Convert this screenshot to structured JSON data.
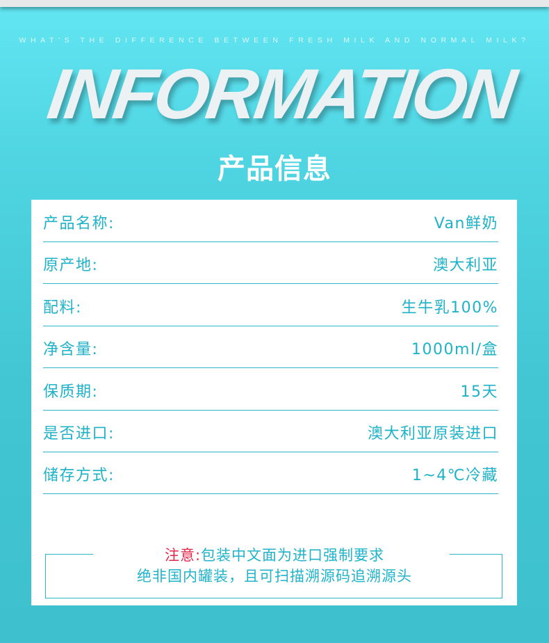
{
  "header": {
    "subtitle": "WHAT'S THE DIFFERENCE BETWEEN FRESH MILK AND NORMAL MILK?",
    "title_en": "INFORMATION",
    "title_cn": "产品信息"
  },
  "specs": [
    {
      "label": "产品名称:",
      "value": "Van鲜奶"
    },
    {
      "label": "原产地:",
      "value": "澳大利亚"
    },
    {
      "label": "配料:",
      "value": "生牛乳100%"
    },
    {
      "label": "净含量:",
      "value": "1000ml/盒"
    },
    {
      "label": "保质期:",
      "value": "15天"
    },
    {
      "label": "是否进口:",
      "value": "澳大利亚原装进口"
    },
    {
      "label": "储存方式:",
      "value": "1~4℃冷藏"
    }
  ],
  "notice": {
    "warning_label": "注意:",
    "line1": "包装中文面为进口强制要求",
    "line2": "绝非国内罐装，且可扫描溯源码追溯源头"
  },
  "colors": {
    "background": "#4fd4e2",
    "accent_text": "#1eb2c9",
    "warning": "#e4264b",
    "card": "#ffffff"
  }
}
